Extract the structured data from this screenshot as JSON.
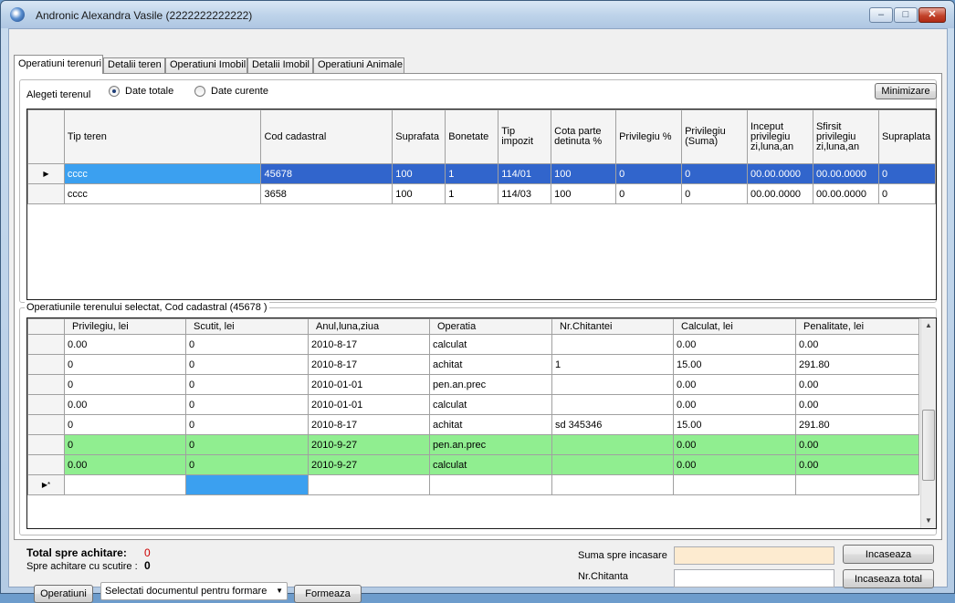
{
  "window": {
    "title": "Andronic Alexandra Vasile (2222222222222)",
    "controls": {
      "minimize": "–",
      "maximize": "□",
      "close": "✕"
    },
    "icon": "app-globe-icon"
  },
  "tabs": [
    {
      "label": "Operatiuni terenuri",
      "active": true
    },
    {
      "label": "Detalii teren",
      "active": false
    },
    {
      "label": "Operatiuni Imobil",
      "active": false
    },
    {
      "label": "Detalii Imobil",
      "active": false
    },
    {
      "label": "Operatiuni Animale",
      "active": false
    }
  ],
  "terrain_group": {
    "legend": "Alegeti terenul",
    "radio_total": "Date totale",
    "radio_current": "Date curente",
    "selected_radio": "total",
    "minimize_button": "Minimizare",
    "columns": [
      "Tip teren",
      "Cod cadastral",
      "Suprafata",
      "Bonetate",
      "Tip impozit",
      "Cota parte detinuta %",
      "Privilegiu %",
      "Privilegiu (Suma)",
      "Inceput privilegiu zi,luna,an",
      "Sfirsit privilegiu zi,luna,an",
      "Supraplata"
    ],
    "rows": [
      [
        "cccc",
        "45678",
        "100",
        "1",
        "114/01",
        "100",
        "0",
        "0",
        "00.00.0000",
        "00.00.0000",
        "0"
      ],
      [
        "cccc",
        "3658",
        "100",
        "1",
        "114/03",
        "100",
        "0",
        "0",
        "00.00.0000",
        "00.00.0000",
        "0"
      ]
    ],
    "selected_row_marker": "▶"
  },
  "operations_group": {
    "legend": "Operatiunile terenului selectat, Cod cadastral (45678 )",
    "columns": [
      "Privilegiu, lei",
      "Scutit, lei",
      "Anul,luna,ziua",
      "Operatia",
      "Nr.Chitantei",
      "Calculat, lei",
      "Penalitate, lei"
    ],
    "rows": [
      [
        "0.00",
        "0",
        "2010-8-17",
        "calculat",
        "",
        "0.00",
        "0.00"
      ],
      [
        "0",
        "0",
        "2010-8-17",
        "achitat",
        "1",
        "15.00",
        "291.80"
      ],
      [
        "0",
        "0",
        "2010-01-01",
        "pen.an.prec",
        "",
        "0.00",
        "0.00"
      ],
      [
        "0.00",
        "0",
        "2010-01-01",
        "calculat",
        "",
        "0.00",
        "0.00"
      ],
      [
        "0",
        "0",
        "2010-8-17",
        "achitat",
        "sd 345346",
        "15.00",
        "291.80"
      ],
      [
        "0",
        "0",
        "2010-9-27",
        "pen.an.prec",
        "",
        "0.00",
        "0.00"
      ],
      [
        "0.00",
        "0",
        "2010-9-27",
        "calculat",
        "",
        "0.00",
        "0.00"
      ]
    ],
    "highlight_rows": [
      5,
      6
    ],
    "highlight_color": "#90ee90",
    "new_row_marker": "▶*"
  },
  "summary": {
    "total_label": "Total spre achitare:",
    "total_value": "0",
    "exempt_label": "Spre achitare cu scutire :",
    "exempt_value": "0",
    "operations_button": "Operatiuni",
    "document_select": "Selectati documentul pentru formare",
    "format_button": "Formeaza",
    "amount_label": "Suma spre incasare",
    "receipt_label": "Nr.Chitanta",
    "collect_button": "Incaseaza",
    "collect_total_button": "Incaseaza total"
  },
  "colors": {
    "selection": "#3165cc",
    "focus_cell": "#3ba0f0",
    "total_value": "#cc0000",
    "amount_input_bg": "#fdebd0"
  }
}
